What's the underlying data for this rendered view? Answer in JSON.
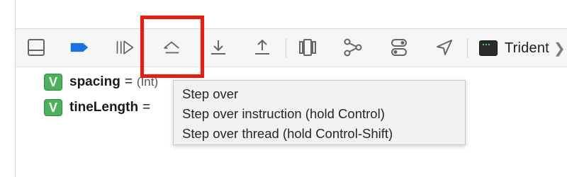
{
  "toolbar": {
    "icons": [
      "hide-debug-area-icon",
      "breakpoints-toggle-icon",
      "continue-icon",
      "step-over-icon",
      "step-into-icon",
      "step-out-icon",
      "view-hierarchy-icon",
      "memory-graph-icon",
      "environment-overrides-icon",
      "simulate-location-icon"
    ],
    "accent_color": "#1a72e8",
    "highlight_color": "#f0190b",
    "scheme_label": "Trident",
    "scheme_chevron": "❯"
  },
  "variables": [
    {
      "badge": "V",
      "name": "spacing",
      "equals": "=",
      "type": "(Int)"
    },
    {
      "badge": "V",
      "name": "tineLength",
      "equals": "=",
      "type": ""
    }
  ],
  "tooltip": {
    "lines": [
      "Step over",
      "Step over instruction (hold Control)",
      "Step over thread (hold Control-Shift)"
    ]
  }
}
